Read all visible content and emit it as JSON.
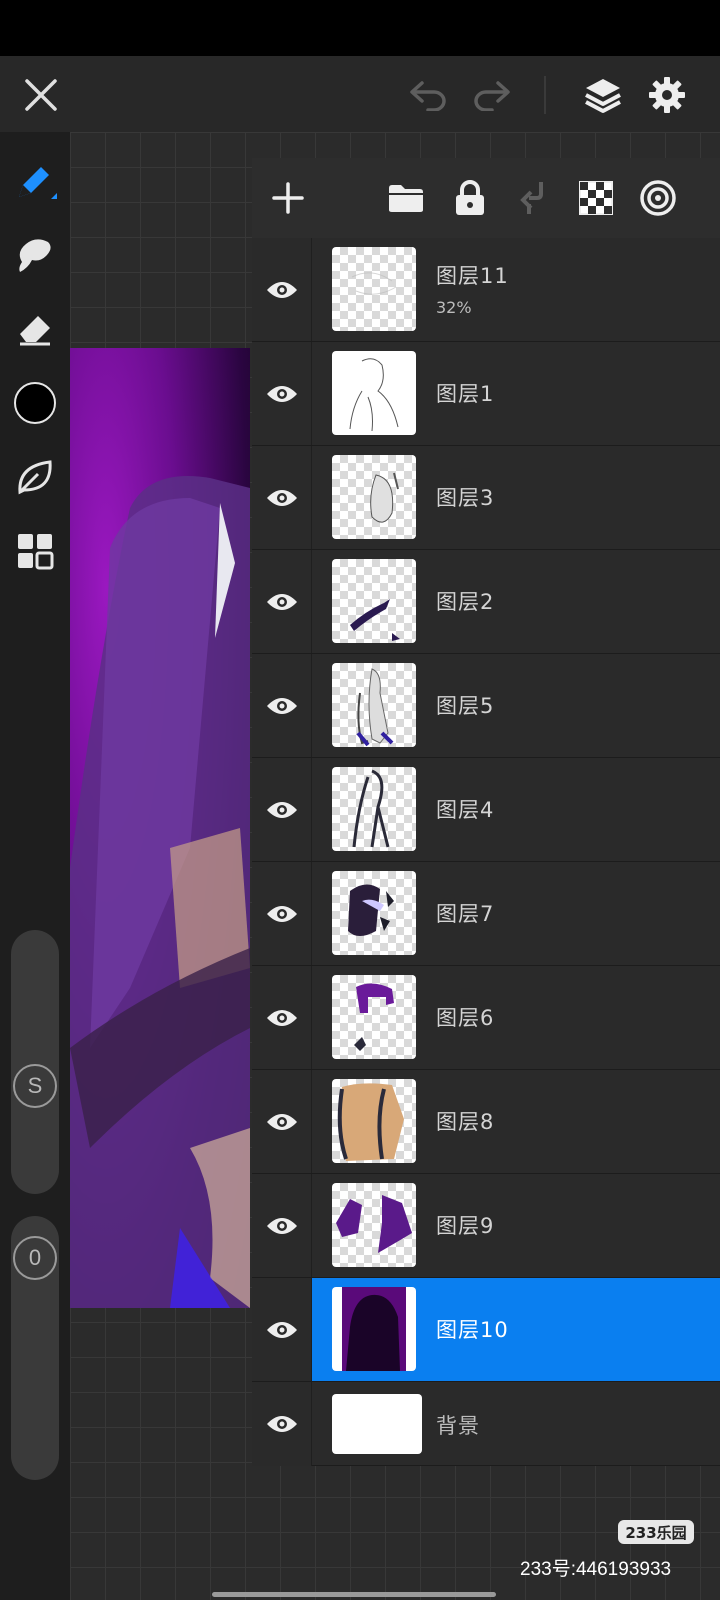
{
  "app": {
    "accent_color": "#0a7ff0",
    "panel_color": "#282828"
  },
  "topbar": {
    "close_icon": "close-icon",
    "undo_icon": "undo-icon",
    "redo_icon": "redo-icon",
    "layers_icon": "layers-icon",
    "settings_icon": "gear-icon"
  },
  "left_tools": [
    {
      "name": "pencil-tool",
      "icon": "pencil-icon",
      "active": true
    },
    {
      "name": "smudge-tool",
      "icon": "smudge-icon"
    },
    {
      "name": "eraser-tool",
      "icon": "eraser-icon"
    },
    {
      "name": "color-swatch",
      "color": "#000000"
    },
    {
      "name": "leaf-tool",
      "icon": "leaf-icon"
    },
    {
      "name": "gallery-tool",
      "icon": "grid-icon"
    }
  ],
  "sliders": {
    "size_label": "S",
    "opacity_label": "0"
  },
  "layer_toolbar": [
    "add-layer-icon",
    "folder-icon",
    "lock-icon",
    "merge-down-icon",
    "transparency-icon",
    "blend-mode-icon"
  ],
  "layers": [
    {
      "name": "图层11",
      "opacity": "32%",
      "visible": true,
      "selected": false
    },
    {
      "name": "图层1",
      "visible": true,
      "selected": false
    },
    {
      "name": "图层3",
      "visible": true,
      "selected": false
    },
    {
      "name": "图层2",
      "visible": true,
      "selected": false
    },
    {
      "name": "图层5",
      "visible": true,
      "selected": false
    },
    {
      "name": "图层4",
      "visible": true,
      "selected": false
    },
    {
      "name": "图层7",
      "visible": true,
      "selected": false
    },
    {
      "name": "图层6",
      "visible": true,
      "selected": false
    },
    {
      "name": "图层8",
      "visible": true,
      "selected": false
    },
    {
      "name": "图层9",
      "visible": true,
      "selected": false
    },
    {
      "name": "图层10",
      "visible": true,
      "selected": true
    },
    {
      "name": "背景",
      "visible": true,
      "selected": false
    }
  ],
  "watermark": {
    "logo": "233乐园",
    "id": "233号:446193933"
  }
}
